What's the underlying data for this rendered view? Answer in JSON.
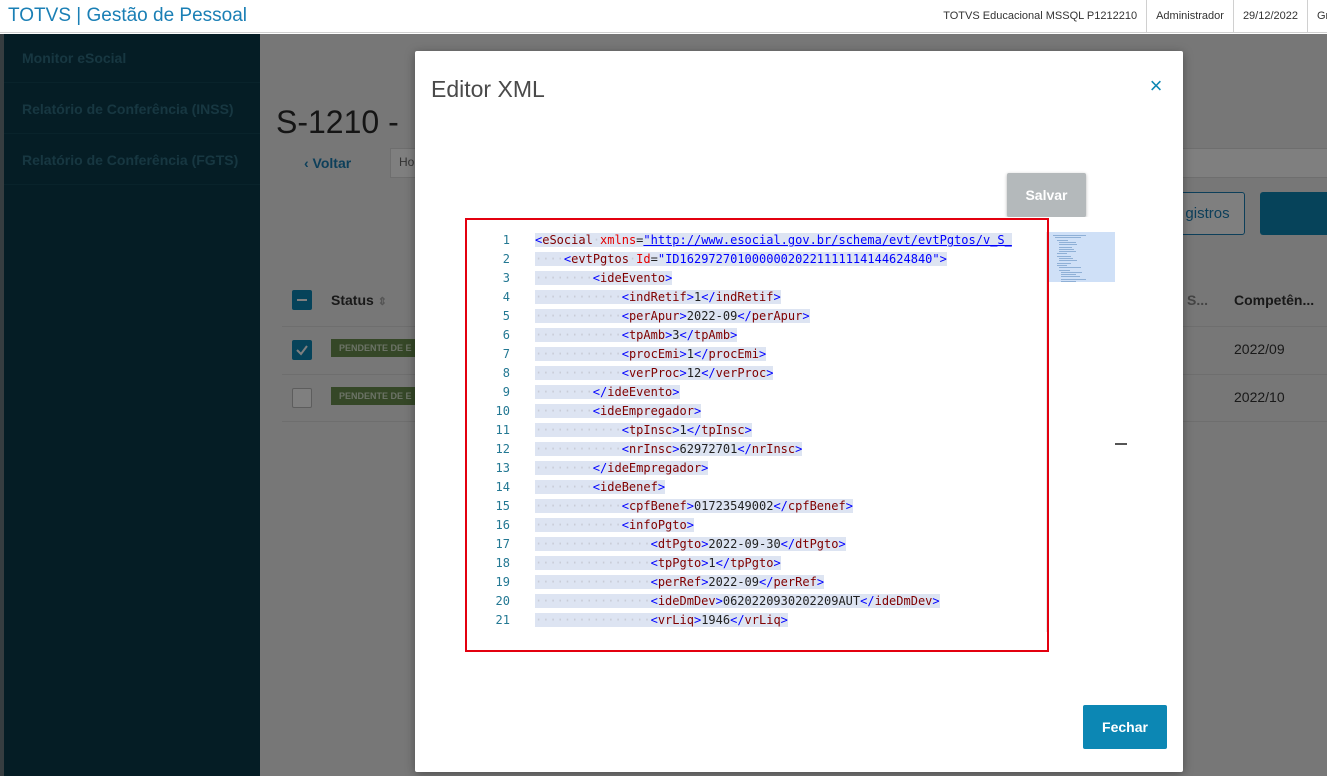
{
  "topbar": {
    "app_title": "TOTVS | Gestão de Pessoal",
    "environment": "TOTVS Educacional MSSQL P1212210",
    "user": "Administrador",
    "date": "29/12/2022",
    "group_clip": "Gru"
  },
  "sidebar": {
    "items": [
      {
        "label": "Monitor eSocial"
      },
      {
        "label": "Relatório de Conferência (INSS)"
      },
      {
        "label": "Relatório de Conferência (FGTS)"
      }
    ]
  },
  "background_page": {
    "title": "S-1210 -",
    "back_label": "‹ Voltar",
    "tab_stub": "Ho",
    "registers_button": "gistros",
    "columns": {
      "status": "Status",
      "col_clip": "S...",
      "competencia": "Competên..."
    },
    "rows": [
      {
        "selected": true,
        "badge": "PENDENTE DE E",
        "competencia": "2022/09"
      },
      {
        "selected": false,
        "badge": "PENDENTE DE E",
        "competencia": "2022/10"
      }
    ]
  },
  "modal": {
    "title": "Editor XML",
    "save_label": "Salvar",
    "close_label": "Fechar",
    "close_icon": "×"
  },
  "editor": {
    "line_numbers": [
      "1",
      "2",
      "3",
      "4",
      "5",
      "6",
      "7",
      "8",
      "9",
      "10",
      "11",
      "12",
      "13",
      "14",
      "15",
      "16",
      "17",
      "18",
      "19",
      "20",
      "21"
    ],
    "lines": [
      "<eSocial xmlns=\"http://www.esocial.gov.br/schema/evt/evtPgtos/v_S_",
      "<evtPgtos Id=\"ID16297270100000020221111114144624840\">",
      "<ideEvento>",
      "<indRetif>1</indRetif>",
      "<perApur>2022-09</perApur>",
      "<tpAmb>3</tpAmb>",
      "<procEmi>1</procEmi>",
      "<verProc>12</verProc>",
      "</ideEvento>",
      "<ideEmpregador>",
      "<tpInsc>1</tpInsc>",
      "<nrInsc>62972701</nrInsc>",
      "</ideEmpregador>",
      "<ideBenef>",
      "<cpfBenef>01723549002</cpfBenef>",
      "<infoPgto>",
      "<dtPgto>2022-09-30</dtPgto>",
      "<tpPgto>1</tpPgto>",
      "<perRef>2022-09</perRef>",
      "<ideDmDev>0620220930202209AUT</ideDmDev>",
      "<vrLiq>1946</vrLiq>"
    ]
  },
  "colors": {
    "accent": "#0c87b4",
    "sidebar_bg": "#0b3a4b",
    "highlight_border": "#e3000f",
    "badge_green": "#6a8f4e"
  }
}
